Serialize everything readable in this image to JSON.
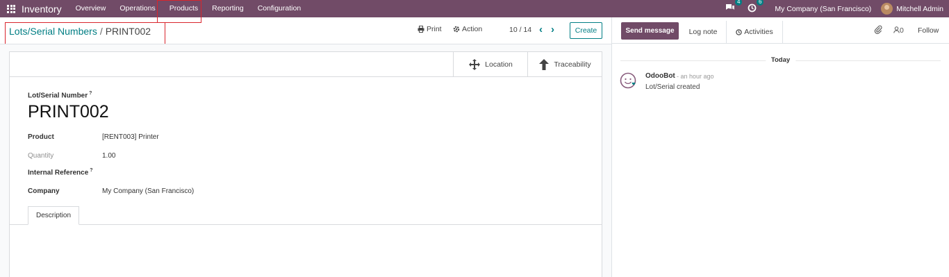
{
  "navbar": {
    "app_name": "Inventory",
    "menu": [
      "Overview",
      "Operations",
      "Products",
      "Reporting",
      "Configuration"
    ],
    "messages_count": "4",
    "activities_count": "6",
    "company": "My Company (San Francisco)",
    "user": "Mitchell Admin"
  },
  "breadcrumb": {
    "parent": "Lots/Serial Numbers",
    "separator": "/",
    "current": "PRINT002"
  },
  "toolbar": {
    "print_label": "Print",
    "action_label": "Action",
    "pager": "10 / 14",
    "create_label": "Create"
  },
  "smart_buttons": {
    "location_label": "Location",
    "traceability_label": "Traceability"
  },
  "form": {
    "lot_label": "Lot/Serial Number",
    "help_mark": "?",
    "lot_name": "PRINT002",
    "product_label": "Product",
    "product_value": "[RENT003] Printer",
    "quantity_label": "Quantity",
    "quantity_value": "1.00",
    "internal_ref_label": "Internal Reference",
    "company_label": "Company",
    "company_value": "My Company (San Francisco)",
    "tab_description": "Description"
  },
  "chatter": {
    "send_message": "Send message",
    "log_note": "Log note",
    "activities": "Activities",
    "followers_count": "0",
    "follow": "Follow",
    "date_separator": "Today",
    "message": {
      "author": "OdooBot",
      "time": "- an hour ago",
      "body": "Lot/Serial created"
    }
  },
  "colors": {
    "brand": "#714b67",
    "accent": "#017e84",
    "highlight": "#d9252d"
  }
}
